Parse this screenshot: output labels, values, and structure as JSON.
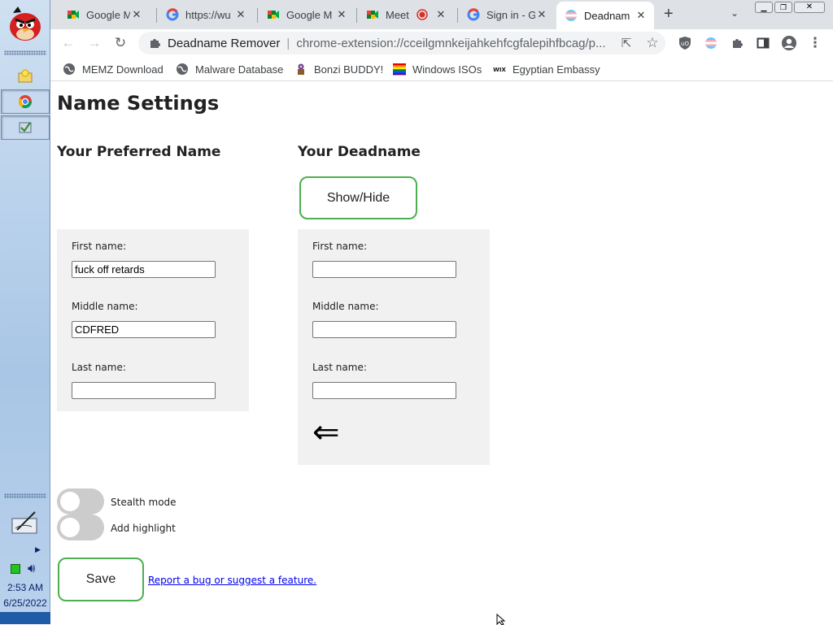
{
  "taskbar": {
    "time": "2:53 AM",
    "date": "6/25/2022"
  },
  "tabs": [
    {
      "title": "Google M",
      "icon": "google-meet-icon"
    },
    {
      "title": "https://wu",
      "icon": "google-g-icon"
    },
    {
      "title": "Google M",
      "icon": "google-meet-icon"
    },
    {
      "title": "Meet",
      "icon": "google-meet-icon",
      "recording": true
    },
    {
      "title": "Sign in - G",
      "icon": "google-g-icon"
    },
    {
      "title": "Deadnam",
      "icon": "trans-flag-icon",
      "active": true
    }
  ],
  "toolbar": {
    "site_name": "Deadname Remover",
    "url": "chrome-extension://cceilgmnkeijahkehfcgfalepihfbcag/p..."
  },
  "bookmarks": [
    {
      "label": "MEMZ Download",
      "icon": "globe-icon"
    },
    {
      "label": "Malware Database",
      "icon": "globe-icon"
    },
    {
      "label": "Bonzi BUDDY!",
      "icon": "bonzi-icon"
    },
    {
      "label": "Windows ISOs",
      "icon": "rainbow-flag-icon"
    },
    {
      "label": "Egyptian Embassy",
      "icon": "wix-icon"
    }
  ],
  "page": {
    "title": "Name Settings",
    "preferred": {
      "heading": "Your Preferred Name",
      "first_label": "First name:",
      "first_value": "fuck off retards",
      "middle_label": "Middle name:",
      "middle_value": "CDFRED",
      "last_label": "Last name:",
      "last_value": ""
    },
    "deadname": {
      "heading": "Your Deadname",
      "show_hide_label": "Show/Hide",
      "first_label": "First name:",
      "first_value": "",
      "middle_label": "Middle name:",
      "middle_value": "",
      "last_label": "Last name:",
      "last_value": "",
      "arrow": "⇐"
    },
    "options": {
      "stealth_label": "Stealth mode",
      "stealth_on": false,
      "highlight_label": "Add highlight",
      "highlight_on": false
    },
    "save_label": "Save",
    "report_link": "Report a bug or suggest a feature."
  },
  "colors": {
    "accent_green": "#4caf50",
    "panel_bg": "#f1f1f1",
    "link": "#0000ee"
  }
}
